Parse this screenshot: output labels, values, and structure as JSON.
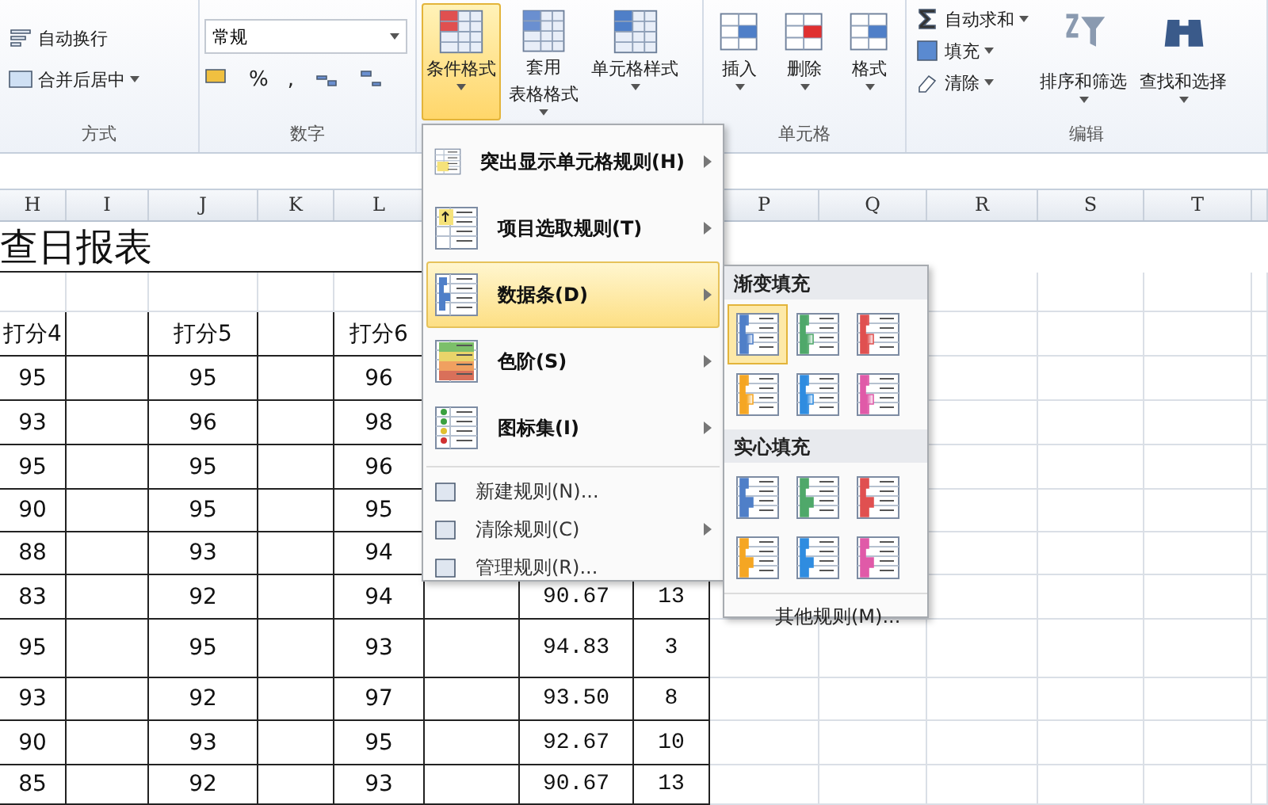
{
  "ribbon": {
    "alignment_group": {
      "label": "方式",
      "wrap_text": "自动换行",
      "merge_center": "合并后居中"
    },
    "number_group": {
      "label": "数字",
      "format": "常规",
      "percent": "%",
      "comma": ","
    },
    "styles_group": {
      "buttons": [
        {
          "lines": [
            "条件格式"
          ],
          "selected": true
        },
        {
          "lines": [
            "套用",
            "表格格式"
          ],
          "selected": false
        },
        {
          "lines": [
            "单元格样式"
          ],
          "selected": false
        }
      ]
    },
    "cells_group": {
      "label": "单元格",
      "buttons": [
        "插入",
        "删除",
        "格式"
      ]
    },
    "editing_group": {
      "label": "编辑",
      "small": [
        "自动求和",
        "填充",
        "清除"
      ],
      "large": [
        "排序和筛选",
        "查找和选择"
      ]
    }
  },
  "sheet": {
    "columns": {
      "h": "H",
      "i": "I",
      "j": "J",
      "k": "K",
      "l": "L",
      "p": "P",
      "q": "Q",
      "r": "R",
      "s": "S",
      "t": "T"
    },
    "title": "查日报表",
    "header": {
      "h": "打分4",
      "j": "打分5",
      "l": "打分6"
    },
    "rows": [
      {
        "h": "95",
        "j": "95",
        "l": "96"
      },
      {
        "h": "93",
        "j": "96",
        "l": "98"
      },
      {
        "h": "95",
        "j": "95",
        "l": "96"
      },
      {
        "h": "90",
        "j": "95",
        "l": "95"
      },
      {
        "h": "88",
        "j": "93",
        "l": "94"
      },
      {
        "h": "83",
        "j": "92",
        "l": "94",
        "n": "90.67",
        "o": "13"
      },
      {
        "h": "95",
        "j": "95",
        "l": "93",
        "n": "94.83",
        "o": "3"
      },
      {
        "h": "93",
        "j": "92",
        "l": "97",
        "n": "93.50",
        "o": "8"
      },
      {
        "h": "90",
        "j": "93",
        "l": "95",
        "n": "92.67",
        "o": "10"
      },
      {
        "h": "85",
        "j": "92",
        "l": "93",
        "n": "90.67",
        "o": "13"
      }
    ]
  },
  "menu": {
    "items": [
      {
        "label": "突出显示单元格规则(H)",
        "kind": "large",
        "submenu": true,
        "selected": false
      },
      {
        "label": "项目选取规则(T)",
        "kind": "large",
        "submenu": true,
        "selected": false
      },
      {
        "label": "数据条(D)",
        "kind": "large",
        "submenu": true,
        "selected": true
      },
      {
        "label": "色阶(S)",
        "kind": "large",
        "submenu": true,
        "selected": false
      },
      {
        "label": "图标集(I)",
        "kind": "large",
        "submenu": true,
        "selected": false
      },
      {
        "label": "新建规则(N)...",
        "kind": "small",
        "submenu": false,
        "selected": false
      },
      {
        "label": "清除规则(C)",
        "kind": "small",
        "submenu": true,
        "selected": false
      },
      {
        "label": "管理规则(R)...",
        "kind": "small",
        "submenu": false,
        "selected": false
      }
    ]
  },
  "submenu": {
    "sections": [
      {
        "title": "渐变填充",
        "kind": "gradient",
        "items": [
          {
            "color": "#4f7fc8",
            "selected": true
          },
          {
            "color": "#4fa86a",
            "selected": false
          },
          {
            "color": "#e05050",
            "selected": false
          },
          {
            "color": "#f5a623",
            "selected": false
          },
          {
            "color": "#2f8ce0",
            "selected": false
          },
          {
            "color": "#e05aa8",
            "selected": false
          }
        ]
      },
      {
        "title": "实心填充",
        "kind": "solid",
        "items": [
          {
            "color": "#4f7fc8",
            "selected": false
          },
          {
            "color": "#4fa86a",
            "selected": false
          },
          {
            "color": "#e05050",
            "selected": false
          },
          {
            "color": "#f5a623",
            "selected": false
          },
          {
            "color": "#2f8ce0",
            "selected": false
          },
          {
            "color": "#e05aa8",
            "selected": false
          }
        ]
      }
    ],
    "more": "其他规则(M)..."
  }
}
